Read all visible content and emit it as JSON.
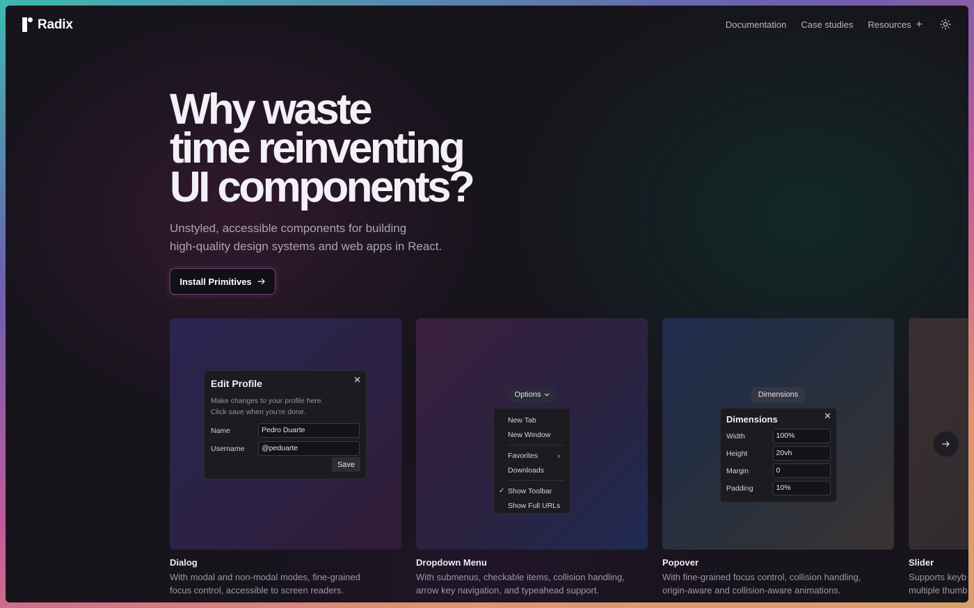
{
  "header": {
    "logo_text": "Radix",
    "nav": [
      "Documentation",
      "Case studies",
      "Resources"
    ],
    "theme_icon": "sun-icon"
  },
  "hero": {
    "title_lines": [
      "Why waste",
      "time reinventing",
      "UI components?"
    ],
    "subtitle_lines": [
      "Unstyled, accessible components for building",
      "high-quality design systems and web apps in React."
    ],
    "cta": "Install Primitives"
  },
  "cards": [
    {
      "title": "Dialog",
      "desc_lines": [
        "With modal and non-modal modes, fine-grained",
        "focus control, accessible to screen readers."
      ],
      "demo": {
        "title": "Edit Profile",
        "desc_lines": [
          "Make changes to your profile here.",
          "Click save when you’re done."
        ],
        "fields": [
          {
            "label": "Name",
            "value": "Pedro Duarte"
          },
          {
            "label": "Username",
            "value": "@peduarte"
          }
        ],
        "save": "Save"
      }
    },
    {
      "title": "Dropdown Menu",
      "desc_lines": [
        "With submenus, checkable items, collision handling,",
        "arrow key navigation, and typeahead support."
      ],
      "demo": {
        "trigger": "Options",
        "items": [
          "New Tab",
          "New Window",
          "Favorites",
          "Downloads",
          "Show Toolbar",
          "Show Full URLs"
        ]
      }
    },
    {
      "title": "Popover",
      "desc_lines": [
        "With fine-grained focus control, collision handling,",
        "origin-aware and collision-aware animations."
      ],
      "demo": {
        "trigger": "Dimensions",
        "title": "Dimensions",
        "fields": [
          {
            "label": "Width",
            "value": "100%"
          },
          {
            "label": "Height",
            "value": "20vh"
          },
          {
            "label": "Margin",
            "value": "0"
          },
          {
            "label": "Padding",
            "value": "10%"
          }
        ]
      }
    },
    {
      "title": "Slider",
      "desc_lines": [
        "Supports keyb",
        "multiple thumb"
      ]
    }
  ]
}
